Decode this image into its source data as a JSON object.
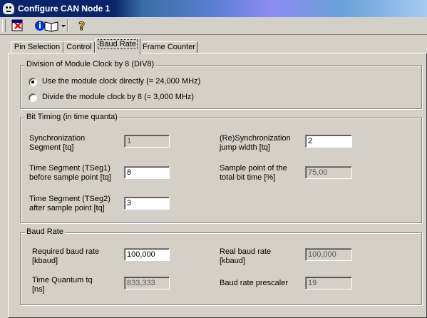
{
  "window": {
    "title": "Configure CAN Node 1"
  },
  "toolbar": {
    "exit_icon": "exit-icon",
    "info_icon": "info-book-icon",
    "dropdown_icon": "dropdown-arrow-icon",
    "help_icon": "help-icon"
  },
  "tabs": [
    {
      "label": "Pin Selection"
    },
    {
      "label": "Control"
    },
    {
      "label": "Baud Rate",
      "active": true
    },
    {
      "label": "Frame Counter"
    }
  ],
  "div8": {
    "title": "Division of Module Clock by 8 (DIV8)",
    "options": [
      {
        "label": "Use the module clock directly (= 24,000 MHz)",
        "selected": true
      },
      {
        "label": "Divide the module clock by 8 (= 3,000 MHz)",
        "selected": false
      }
    ]
  },
  "bit_timing": {
    "title": "Bit Timing (in time quanta)",
    "sync_seg": {
      "label_1": "Synchronization",
      "label_2": "Segment [tq]",
      "value": "1"
    },
    "tseg1": {
      "label_1": "Time Segment (TSeg1)",
      "label_2": "before sample point [tq]",
      "value": "8"
    },
    "tseg2": {
      "label_1": "Time Segment (TSeg2)",
      "label_2": "after sample point [tq]",
      "value": "3"
    },
    "sjw": {
      "label_1": "(Re)Synchronization",
      "label_2": "jump width [tq]",
      "value": "2"
    },
    "sample_point": {
      "label_1": "Sample point of the",
      "label_2": "total bit time [%]",
      "value": "75,00"
    }
  },
  "baud_rate": {
    "title": "Baud Rate",
    "required": {
      "label_1": "Required baud rate",
      "label_2": "[kbaud]",
      "value": "100,000"
    },
    "real": {
      "label_1": "Real baud rate",
      "label_2": "[kbaud]",
      "value": "100,000"
    },
    "tq": {
      "label_1": "Time Quantum tq",
      "label_2": "[ns]",
      "value": "833,333"
    },
    "prescaler": {
      "label": "Baud rate prescaler",
      "value": "19"
    }
  }
}
